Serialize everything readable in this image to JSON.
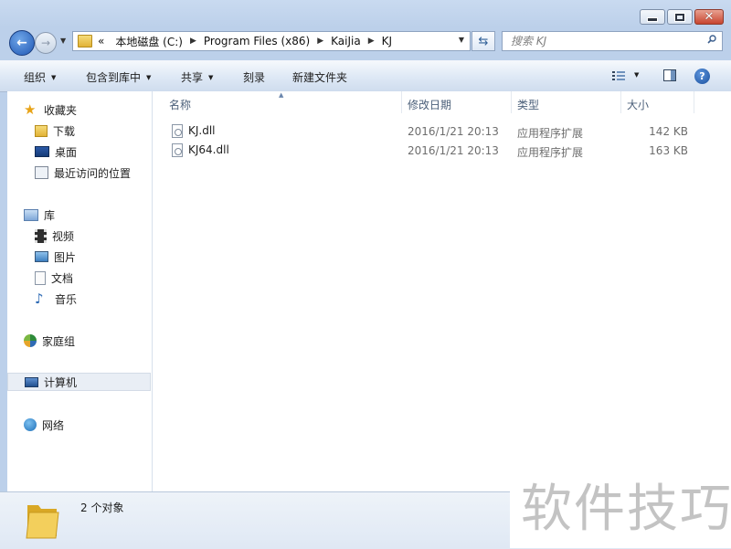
{
  "window": {
    "minimize_label": "",
    "maximize_label": "",
    "close_label": "✕"
  },
  "address": {
    "chevron": "«",
    "crumbs": [
      "本地磁盘 (C:)",
      "Program Files (x86)",
      "KaiJia",
      "KJ"
    ]
  },
  "search": {
    "placeholder": "搜索 KJ"
  },
  "commands": {
    "organize": "组织",
    "include_library": "包含到库中",
    "share": "共享",
    "burn": "刻录",
    "new_folder": "新建文件夹"
  },
  "nav": {
    "favorites": "收藏夹",
    "downloads": "下载",
    "desktop": "桌面",
    "recent": "最近访问的位置",
    "libraries": "库",
    "videos": "视频",
    "pictures": "图片",
    "documents": "文档",
    "music": "音乐",
    "homegroup": "家庭组",
    "computer": "计算机",
    "network": "网络"
  },
  "columns": {
    "name": "名称",
    "date": "修改日期",
    "type": "类型",
    "size": "大小"
  },
  "files": [
    {
      "name": "KJ.dll",
      "date": "2016/1/21 20:13",
      "type": "应用程序扩展",
      "size": "142 KB"
    },
    {
      "name": "KJ64.dll",
      "date": "2016/1/21 20:13",
      "type": "应用程序扩展",
      "size": "163 KB"
    }
  ],
  "status": {
    "count": "2 个对象"
  },
  "watermark": {
    "text": "软件技巧"
  },
  "colors": {
    "accent": "#1f57b4",
    "header_text": "#4c607a",
    "secondary_text": "#6d6d6d",
    "folder_yellow": "#e1b236"
  }
}
